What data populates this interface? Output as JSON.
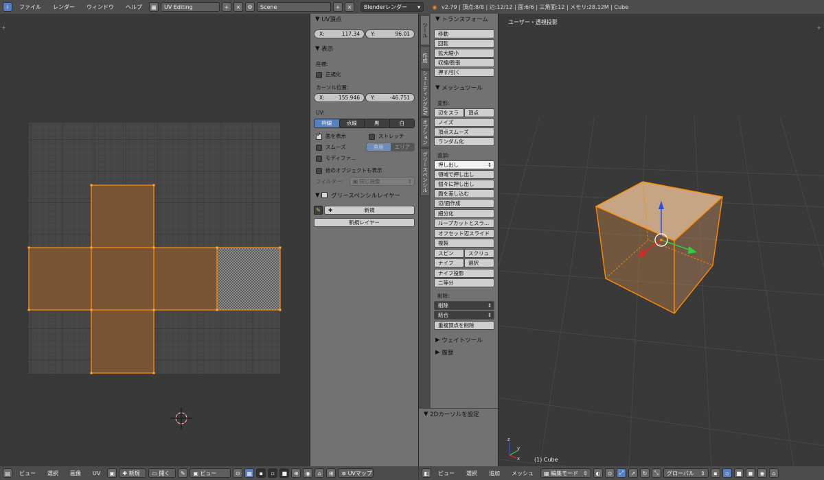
{
  "info_header": {
    "menus": [
      "ファイル",
      "レンダー",
      "ウィンドウ",
      "ヘルプ"
    ],
    "screen_layout": "UV Editing",
    "scene": "Scene",
    "render_engine": "Blenderレンダー",
    "stats": "v2.79 | 頂点:8/8 | 辺:12/12 | 面:6/6 | 三角面:12 | メモリ:28.12M | Cube"
  },
  "uv_panel": {
    "uv_vertex": {
      "title": "UV頂点",
      "x_label": "X:",
      "x_value": "117.34",
      "y_label": "Y:",
      "y_value": "96.01"
    },
    "display": {
      "title": "表示",
      "coords_label": "座標:",
      "normalized": "正規化",
      "cursor_label": "カーソル位置:",
      "cursor_x_label": "X:",
      "cursor_x": "155.946",
      "cursor_y_label": "Y:",
      "cursor_y": "-46.751",
      "uv_label": "UV:",
      "uv_modes": [
        "枠線",
        "点線",
        "黒",
        "白"
      ],
      "draw_faces": "面を表示",
      "stretch": "ストレッチ",
      "smooth": "スムーズ",
      "angle": "角度",
      "area": "エリア",
      "modifier": "モディファ...",
      "other_objects": "他のオブジェクトも表示",
      "filter_label": "フィルター:",
      "filter_value": "同じ画像"
    },
    "grease": {
      "title": "グリースペンシルレイヤー",
      "new": "新規",
      "new_layer": "新規レイヤー"
    }
  },
  "tool_tabs": [
    "ツール",
    "作成",
    "シェーディング/UV",
    "オプション",
    "グリースペンシル"
  ],
  "tool_shelf": {
    "transform_title": "トランスフォーム",
    "transform": [
      "移動",
      "回転",
      "拡大縮小",
      "収縮/膨張",
      "押す/引く"
    ],
    "mesh_title": "メッシュツール",
    "deform_label": "変形:",
    "slide_edge": "辺をスラ",
    "slide_vertex": "頂点",
    "noise": "ノイズ",
    "smooth_vertex": "頂点スムーズ",
    "randomize": "ランダム化",
    "add_label": "追加:",
    "extrude": "押し出し",
    "add_list": [
      "領域で押し出し",
      "個々に押し出し",
      "面を差し込む",
      "辺/面作成",
      "細分化",
      "ループカットとスラ...",
      "オフセット辺スライド",
      "複製"
    ],
    "spin": "スピン",
    "screw": "スクリュ",
    "knife": "ナイフ",
    "knife_select": "選択",
    "knife_project": "ナイフ投影",
    "bisect": "二等分",
    "remove_label": "削除:",
    "delete": "削除",
    "merge": "結合",
    "remove_doubles": "重複頂点を削除",
    "weight_title": "ウェイトツール",
    "history_title": "履歴",
    "cursor_2d_title": "2Dカーソルを設定"
  },
  "viewport": {
    "view_label": "ユーザー・透視投影",
    "object_label": "(1) Cube"
  },
  "uv_footer": {
    "menus": [
      "ビュー",
      "選択",
      "画像",
      "UV"
    ],
    "new_label": "新規",
    "open_label": "開く",
    "view_label": "ビュー",
    "uvmap": "UVマップ"
  },
  "view3d_footer": {
    "menus": [
      "ビュー",
      "選択",
      "追加",
      "メッシュ"
    ],
    "mode": "編集モード",
    "orientation": "グローバル"
  },
  "colors": {
    "uv_face": "#7a5535",
    "selection": "#ff8c00",
    "active_tab": "#5680c2",
    "cube_top": "#c6a584"
  }
}
